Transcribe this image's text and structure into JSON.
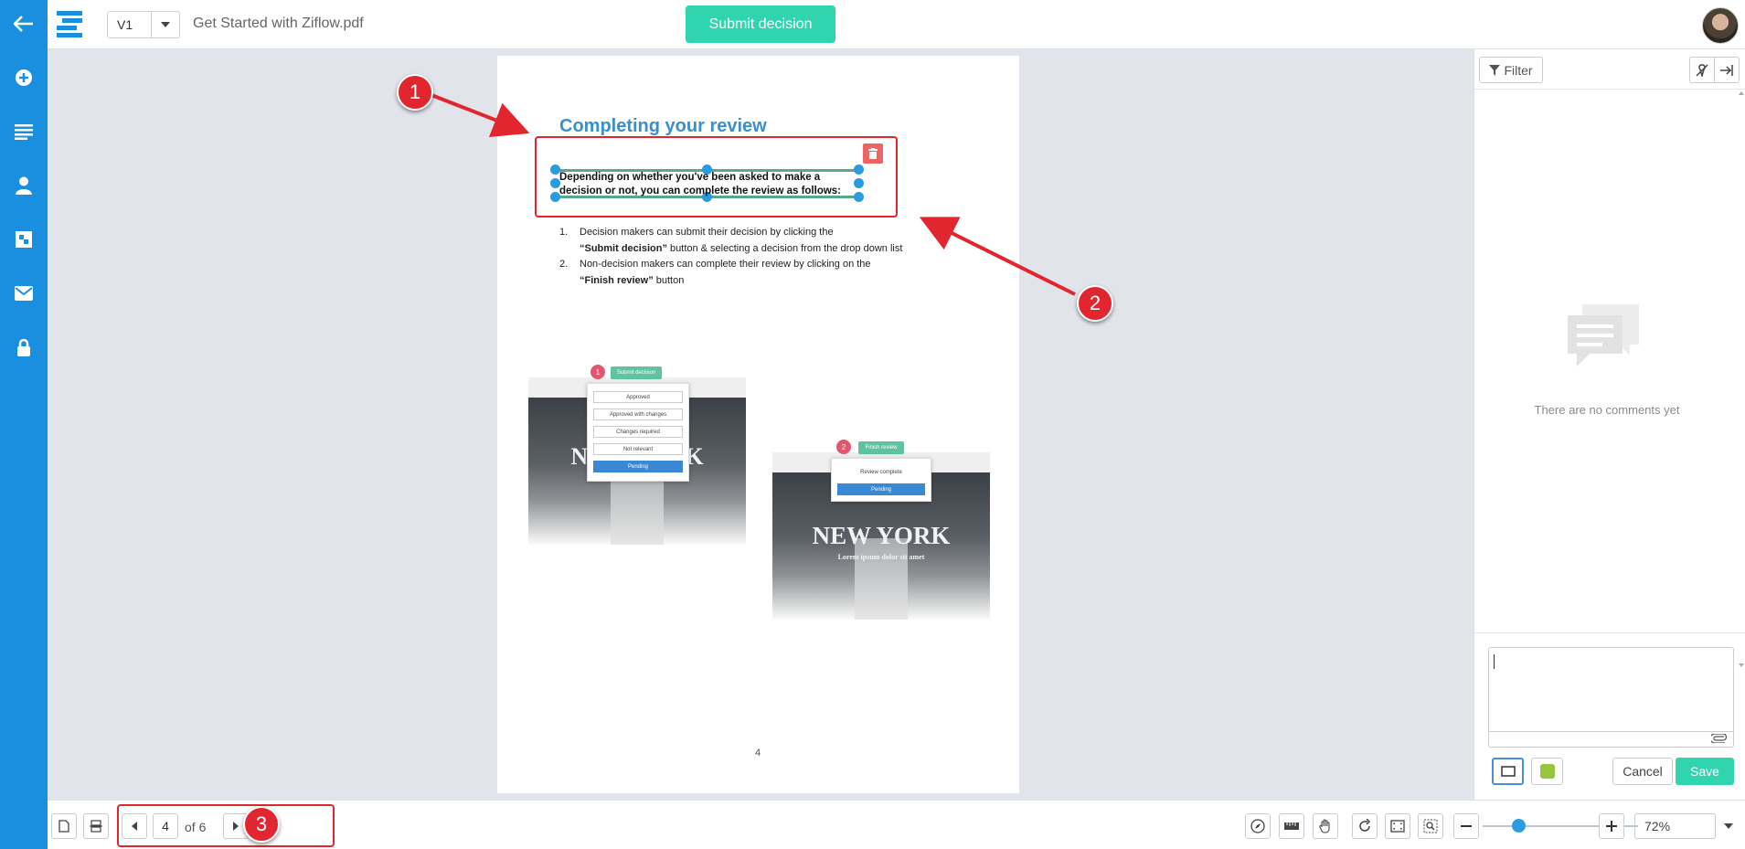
{
  "header": {
    "version": "V1",
    "file_name": "Get Started with Ziflow.pdf",
    "submit_label": "Submit decision"
  },
  "document": {
    "title": "Completing your review",
    "selected_text": "Depending on whether you've been asked to make a decision or not, you can complete the review as follows:",
    "list": [
      {
        "num": "1.",
        "pre": "Decision makers can submit their decision by clicking the",
        "bold": "“Submit decision”",
        "post": " button & selecting a decision from the drop down list"
      },
      {
        "num": "2.",
        "pre": "Non-decision makers can complete their review by clicking on the ",
        "bold": "“Finish review”",
        "post": " button"
      }
    ],
    "page_number": "4",
    "figure1": {
      "badge": "1",
      "button": "Submit decision",
      "options": [
        "Approved",
        "Approved with changes",
        "Changes required",
        "Not relevant",
        "Pending"
      ],
      "caption": "NEW YORK"
    },
    "figure2": {
      "badge": "2",
      "button": "Finish review",
      "options": [
        "Review complete",
        "Pending"
      ],
      "caption": "NEW YORK",
      "subcaption": "Lorem ipsum dolor sit amet"
    }
  },
  "callouts": [
    "1",
    "2",
    "3"
  ],
  "comments_panel": {
    "filter_label": "Filter",
    "empty_text": "There are no comments yet",
    "cancel_label": "Cancel",
    "save_label": "Save",
    "annotation_color": "#9ac33f"
  },
  "footer": {
    "current_page": "4",
    "of_pages": "of 6",
    "zoom": "72%"
  },
  "colors": {
    "rail": "#1a8fe0",
    "accent": "#30d5b0",
    "callout": "#e22630"
  }
}
